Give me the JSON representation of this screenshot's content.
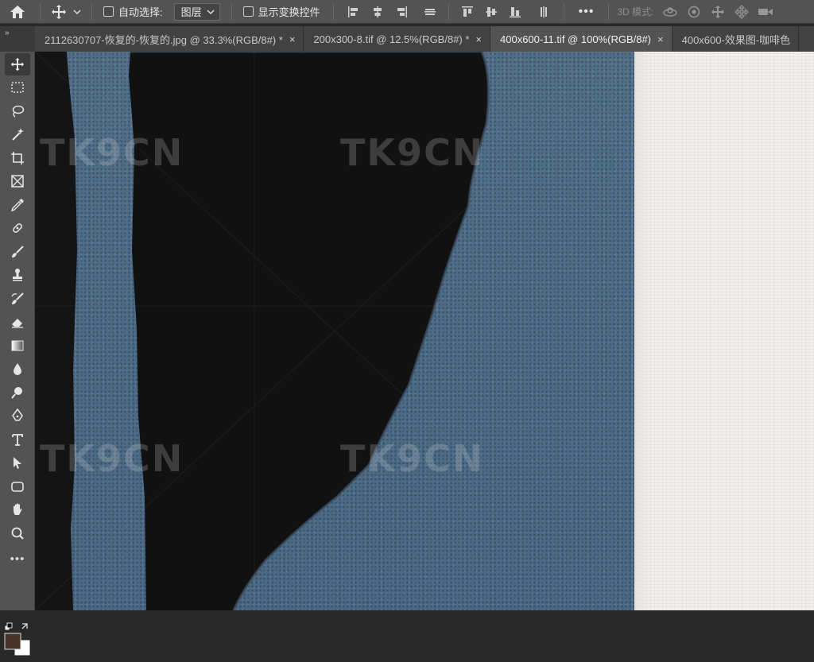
{
  "options_bar": {
    "home_icon": "home-icon",
    "move_tool_icon": "move-icon",
    "auto_select_label": "自动选择:",
    "auto_select_checked": false,
    "auto_select_target": "图层",
    "show_transform_label": "显示变换控件",
    "show_transform_checked": false,
    "align_icons": [
      "align-left-edges-icon",
      "align-horizontal-centers-icon",
      "align-right-edges-icon",
      "distribute-horizontal-icon",
      "align-top-edges-icon",
      "align-vertical-centers-icon",
      "align-bottom-edges-icon",
      "distribute-vertical-icon"
    ],
    "more_label": "•••",
    "mode_3d_label": "3D 模式:",
    "mode_3d_icons": [
      "orbit-3d-icon",
      "roll-3d-icon",
      "pan-3d-icon",
      "slide-3d-icon",
      "scale-3d-icon"
    ]
  },
  "tabs": [
    {
      "title": "2112630707-恢复的-恢复的.jpg @ 33.3%(RGB/8#) *",
      "active": false
    },
    {
      "title": "200x300-8.tif @ 12.5%(RGB/8#) *",
      "active": false
    },
    {
      "title": "400x600-11.tif @ 100%(RGB/8#)",
      "active": true
    },
    {
      "title": "400x600-效果图-咖啡色",
      "active": false
    }
  ],
  "tab_close_label": "×",
  "panel_chevron": "»",
  "toolbar": {
    "tools": [
      "move-tool-icon",
      "marquee-tool-icon",
      "lasso-tool-icon",
      "magic-wand-tool-icon",
      "crop-tool-icon",
      "frame-tool-icon",
      "eyedropper-tool-icon",
      "healing-brush-tool-icon",
      "brush-tool-icon",
      "clone-stamp-tool-icon",
      "history-brush-tool-icon",
      "eraser-tool-icon",
      "gradient-tool-icon",
      "blur-tool-icon",
      "dodge-tool-icon",
      "pen-tool-icon",
      "type-tool-icon",
      "path-selection-tool-icon",
      "rectangle-tool-icon",
      "hand-tool-icon",
      "zoom-tool-icon"
    ],
    "active_tool": "move-tool-icon",
    "more_label": "•••",
    "foreground_color": "#4a3328",
    "background_color": "#ffffff"
  },
  "canvas": {
    "watermark": "TK9CN",
    "blue_color": "#4d6c88",
    "dark_color": "#0f0f0f",
    "paper_color": "#f2efec"
  }
}
